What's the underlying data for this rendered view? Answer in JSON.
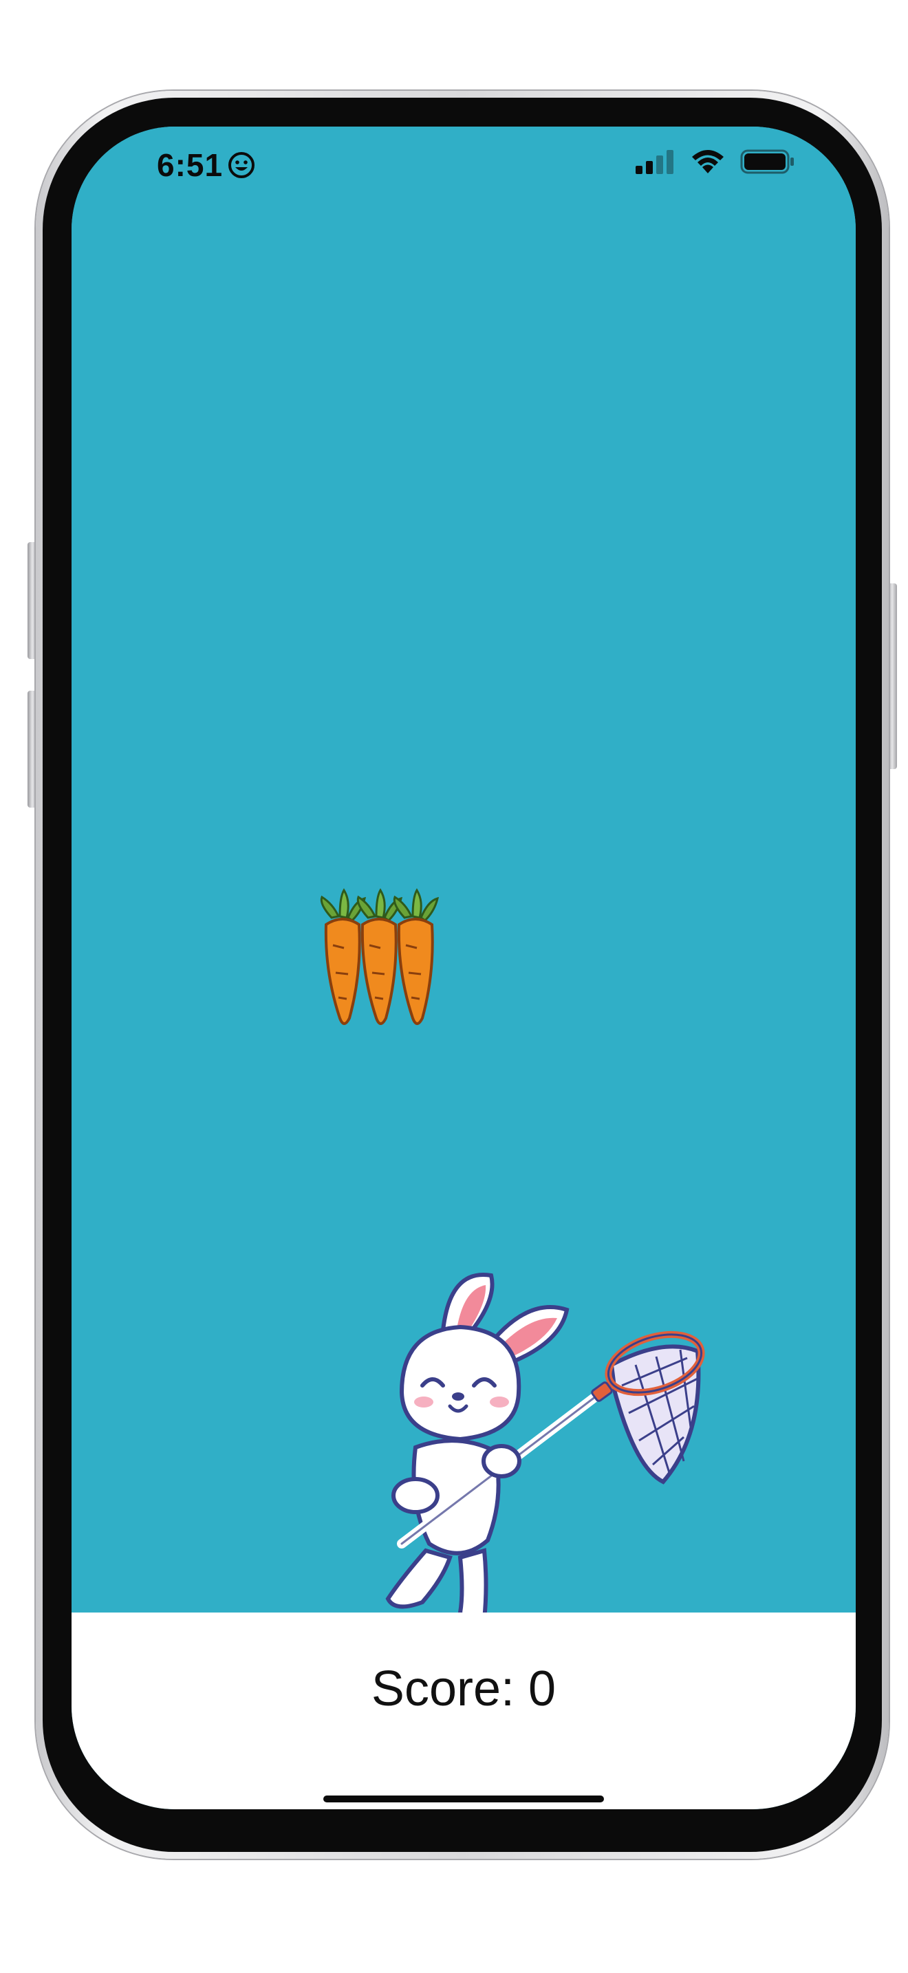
{
  "status_bar": {
    "time": "6:51",
    "status_icons": [
      "smiley-icon",
      "cellular-signal-icon",
      "wifi-icon",
      "battery-icon"
    ]
  },
  "game": {
    "background_color": "#30afc7",
    "falling_item": "carrots-icon",
    "player": "bunny-with-net-icon"
  },
  "score_panel": {
    "score_text": "Score: 0"
  },
  "colors": {
    "game_bg": "#30afc7",
    "score_bg": "#ffffff",
    "carrot_orange": "#f08a1e",
    "carrot_leaf": "#6aa337",
    "net_rim": "#e1603b",
    "outline": "#3b3f8a"
  }
}
